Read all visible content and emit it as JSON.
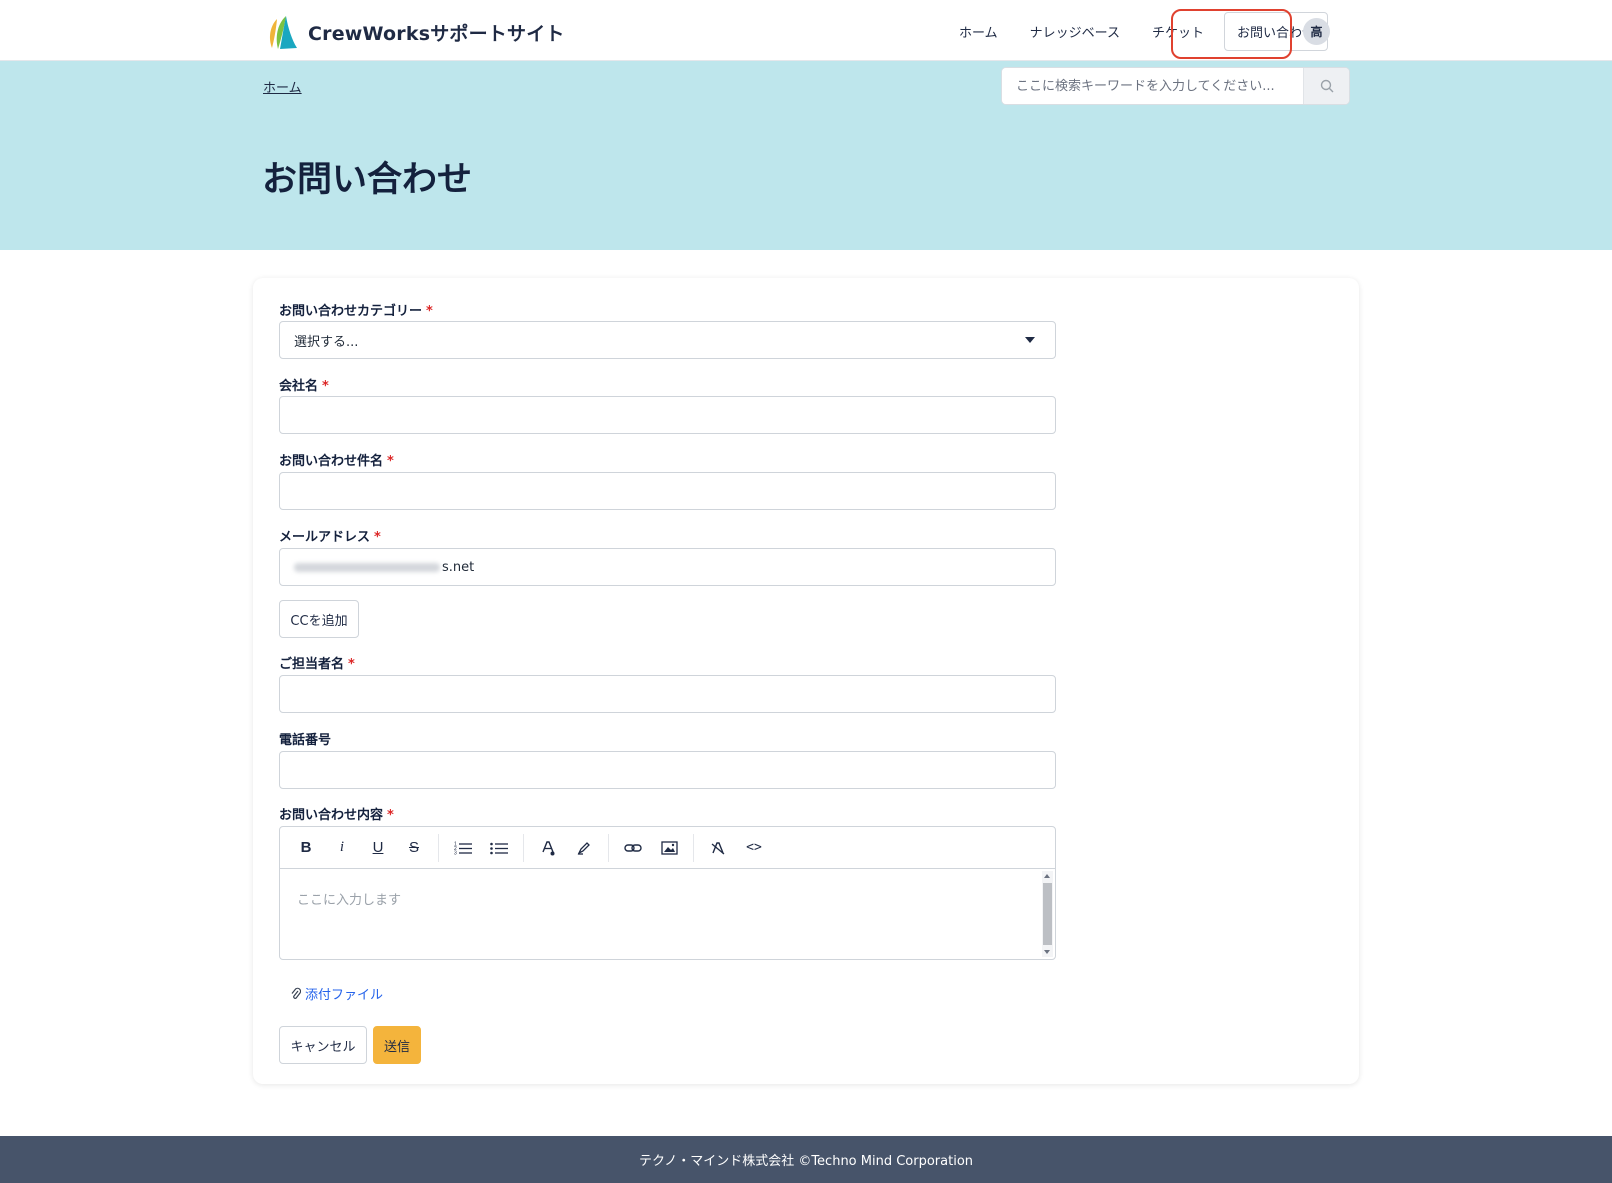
{
  "header": {
    "site_title": "CrewWorksサポートサイト",
    "nav": [
      {
        "label": "ホーム"
      },
      {
        "label": "ナレッジベース"
      },
      {
        "label": "チケット"
      },
      {
        "label": "お問い合わせ"
      }
    ],
    "avatar_initial": "高"
  },
  "banner": {
    "breadcrumb": "ホーム",
    "search_placeholder": "ここに検索キーワードを入力してください...",
    "page_title": "お問い合わせ"
  },
  "form": {
    "category": {
      "label": "お問い合わせカテゴリー",
      "required_mark": "*",
      "value": "選択する..."
    },
    "company": {
      "label": "会社名",
      "required_mark": "*",
      "value": ""
    },
    "subject": {
      "label": "お問い合わせ件名",
      "required_mark": "*",
      "value": ""
    },
    "email": {
      "label": "メールアドレス",
      "required_mark": "*",
      "value_visible_suffix": "s.net"
    },
    "add_cc_label": "CCを追加",
    "contact_name": {
      "label": "ご担当者名",
      "required_mark": "*",
      "value": ""
    },
    "phone": {
      "label": "電話番号",
      "value": ""
    },
    "content": {
      "label": "お問い合わせ内容",
      "required_mark": "*",
      "placeholder": "ここに入力します"
    },
    "toolbar_icons": [
      "bold-icon",
      "italic-icon",
      "underline-icon",
      "strikethrough-icon",
      "ordered-list-icon",
      "bullet-list-icon",
      "text-color-icon",
      "highlight-icon",
      "link-icon",
      "image-icon",
      "clear-format-icon",
      "code-view-icon"
    ],
    "toolbar_glyphs": {
      "bold": "B",
      "italic": "i",
      "underline": "U",
      "strike": "S",
      "code": "<>"
    },
    "attachment_label": "添付ファイル",
    "cancel_label": "キャンセル",
    "submit_label": "送信"
  },
  "footer": {
    "text": "テクノ・マインド株式会社 ©Techno Mind Corporation"
  },
  "colors": {
    "banner_bg": "#bee6ec",
    "primary_button": "#f4b43c",
    "footer_bg": "#47546a",
    "required": "#dc2626",
    "active_highlight": "#e0412f"
  }
}
